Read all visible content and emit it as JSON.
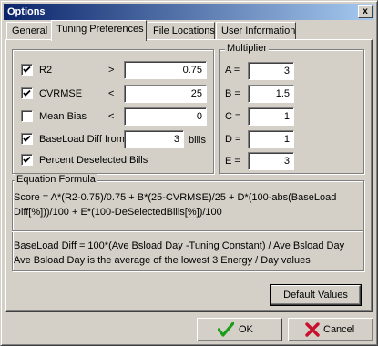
{
  "window": {
    "title": "Options",
    "close_glyph": "x"
  },
  "tabs": [
    {
      "label": "General",
      "active": false
    },
    {
      "label": "Tuning Preferences",
      "active": true
    },
    {
      "label": "File Locations",
      "active": false
    },
    {
      "label": "User Information",
      "active": false
    }
  ],
  "criteria": {
    "rows": [
      {
        "label": "R2",
        "checked": true,
        "operator": ">",
        "value": "0.75"
      },
      {
        "label": "CVRMSE",
        "checked": true,
        "operator": "<",
        "value": "25"
      },
      {
        "label": "Mean Bias",
        "checked": false,
        "operator": "<",
        "value": "0"
      }
    ],
    "baseload": {
      "label": "BaseLoad Diff from",
      "checked": true,
      "value": "3",
      "unit": "bills"
    },
    "percent_deselected": {
      "label": "Percent Deselected Bills",
      "checked": true
    }
  },
  "multiplier": {
    "title": "Multiplier",
    "rows": [
      {
        "label": "A =",
        "value": "3"
      },
      {
        "label": "B =",
        "value": "1.5"
      },
      {
        "label": "C =",
        "value": "1"
      },
      {
        "label": "D =",
        "value": "1"
      },
      {
        "label": "E =",
        "value": "3"
      }
    ]
  },
  "equation": {
    "title": "Equation Formula",
    "formula_line1": "Score = A*(R2-0.75)/0.75 + B*(25-CVRMSE)/25 + D*(100-abs(BaseLoad",
    "formula_line2": "Diff[%]))/100 + E*(100-DeSelectedBills[%])/100",
    "baseload_def": "BaseLoad Diff = 100*(Ave Bsload Day -Tuning Constant) / Ave Bsload Day",
    "average_def": "Ave Bsload Day is the average of the lowest 3 Energy / Day values"
  },
  "buttons": {
    "default_values": "Default Values",
    "ok": "OK",
    "cancel": "Cancel"
  },
  "colors": {
    "title_start": "#0a246a",
    "title_end": "#a6caf0",
    "ok_green": "#1a9e1a",
    "cancel_red": "#c8102e"
  }
}
